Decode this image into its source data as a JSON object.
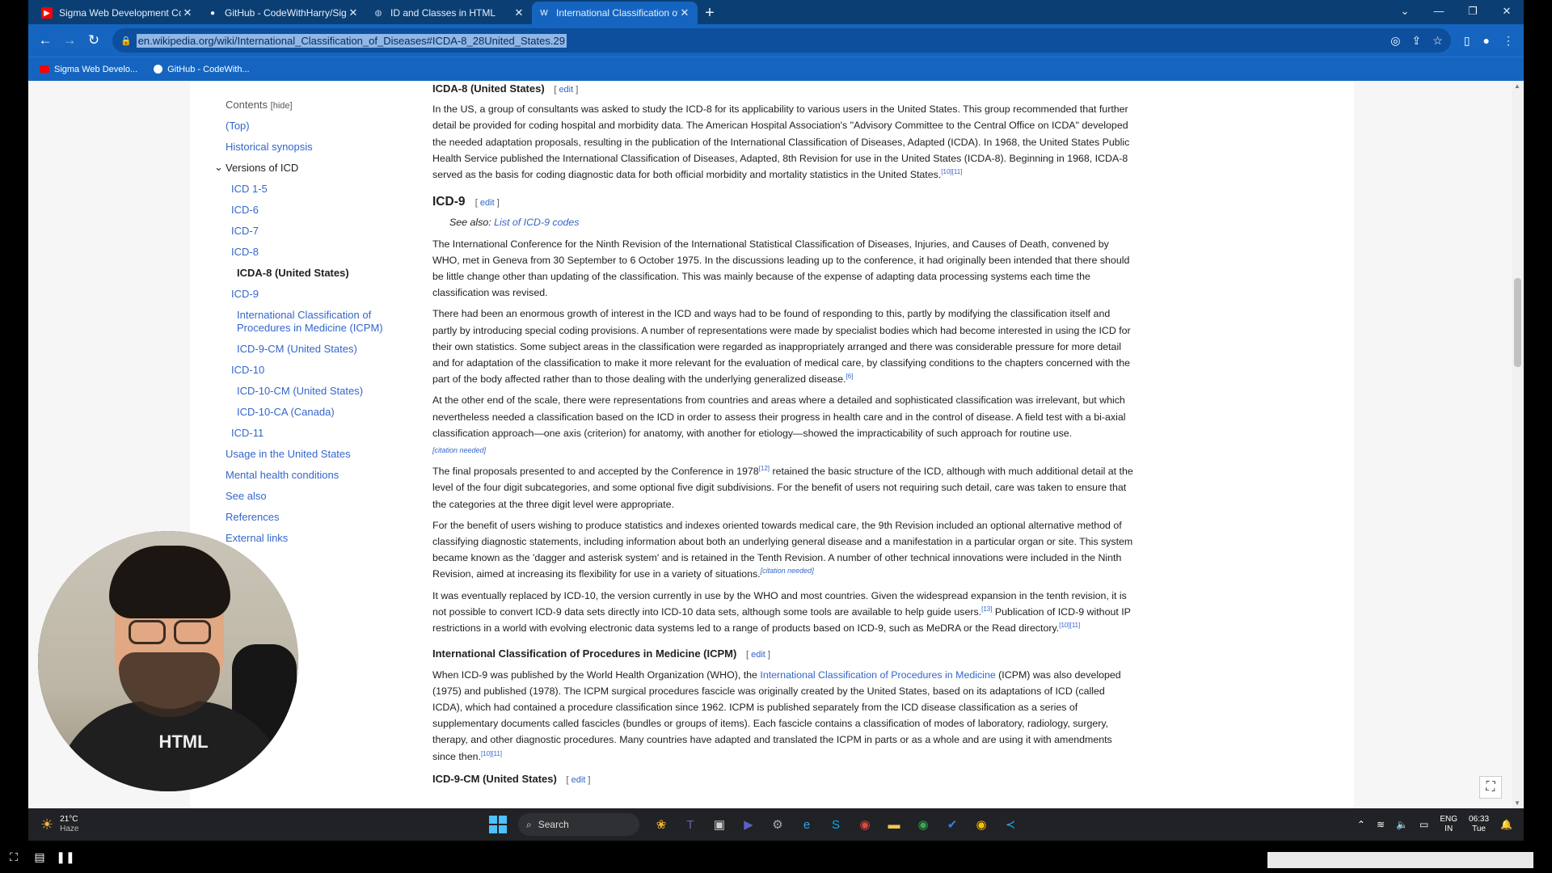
{
  "tabs": [
    {
      "title": "Sigma Web Development Course",
      "color": "#ff0000",
      "glyph": "▶"
    },
    {
      "title": "GitHub - CodeWithHarry/Sigma",
      "color": "#ffffff",
      "glyph": "●"
    },
    {
      "title": "ID and Classes in HTML",
      "color": "#bcd3f3",
      "glyph": "◍"
    },
    {
      "title": "International Classification of Dis",
      "color": "#ffffff",
      "glyph": "W"
    }
  ],
  "new_tab": "+",
  "window_controls": {
    "list": "⌄",
    "minimize": "—",
    "restore": "❐",
    "close": "✕"
  },
  "address_bar": {
    "url": "en.wikipedia.org/wiki/International_Classification_of_Diseases#ICDA-8_28United_States.29"
  },
  "bookmarks": [
    {
      "label": "Sigma Web Develo...",
      "color": "#ff0000"
    },
    {
      "label": "GitHub - CodeWith...",
      "color": "#ffffff"
    }
  ],
  "toc": {
    "title": "Contents",
    "hide": "[hide]",
    "items": [
      {
        "label": "(Top)",
        "level": 1
      },
      {
        "label": "Historical synopsis",
        "level": 1
      },
      {
        "label": "Versions of ICD",
        "level": 1,
        "group": true
      },
      {
        "label": "ICD 1-5",
        "level": 2
      },
      {
        "label": "ICD-6",
        "level": 2
      },
      {
        "label": "ICD-7",
        "level": 2
      },
      {
        "label": "ICD-8",
        "level": 2
      },
      {
        "label": "ICDA-8 (United States)",
        "level": 3,
        "current": true
      },
      {
        "label": "ICD-9",
        "level": 2
      },
      {
        "label": "International Classification of Procedures in Medicine (ICPM)",
        "level": 3
      },
      {
        "label": "ICD-9-CM (United States)",
        "level": 3
      },
      {
        "label": "ICD-10",
        "level": 2
      },
      {
        "label": "ICD-10-CM (United States)",
        "level": 3
      },
      {
        "label": "ICD-10-CA (Canada)",
        "level": 3
      },
      {
        "label": "ICD-11",
        "level": 2
      },
      {
        "label": "Usage in the United States",
        "level": 1
      },
      {
        "label": "Mental health conditions",
        "level": 1
      },
      {
        "label": "See also",
        "level": 1
      },
      {
        "label": "References",
        "level": 1
      },
      {
        "label": "External links",
        "level": 1
      }
    ]
  },
  "article": {
    "edit_label": "edit",
    "icda8": {
      "heading": "ICDA-8 (United States)",
      "p1": "In the US, a group of consultants was asked to study the ICD-8 for its applicability to various users in the United States. This group recommended that further detail be provided for coding hospital and morbidity data. The American Hospital Association's \"Advisory Committee to the Central Office on ICDA\" developed the needed adaptation proposals, resulting in the publication of the International Classification of Diseases, Adapted (ICDA). In 1968, the United States Public Health Service published the International Classification of Diseases, Adapted, 8th Revision for use in the United States (ICDA-8). Beginning in 1968, ICDA-8 served as the basis for coding diagnostic data for both official morbidity and mortality statistics in the United States.",
      "p1_ref": "[10][11]"
    },
    "icd9": {
      "heading": "ICD-9",
      "see_also": "See also:",
      "see_also_link": "List of ICD-9 codes",
      "p1": "The International Conference for the Ninth Revision of the International Statistical Classification of Diseases, Injuries, and Causes of Death, convened by WHO, met in Geneva from 30 September to 6 October 1975. In the discussions leading up to the conference, it had originally been intended that there should be little change other than updating of the classification. This was mainly because of the expense of adapting data processing systems each time the classification was revised.",
      "p2": "There had been an enormous growth of interest in the ICD and ways had to be found of responding to this, partly by modifying the classification itself and partly by introducing special coding provisions. A number of representations were made by specialist bodies which had become interested in using the ICD for their own statistics. Some subject areas in the classification were regarded as inappropriately arranged and there was considerable pressure for more detail and for adaptation of the classification to make it more relevant for the evaluation of medical care, by classifying conditions to the chapters concerned with the part of the body affected rather than to those dealing with the underlying generalized disease.",
      "p2_ref": "[6]",
      "p3": "At the other end of the scale, there were representations from countries and areas where a detailed and sophisticated classification was irrelevant, but which nevertheless needed a classification based on the ICD in order to assess their progress in health care and in the control of disease. A field test with a bi-axial classification approach—one axis (criterion) for anatomy, with another for etiology—showed the impracticability of such approach for routine use.",
      "p3_ref": "[citation needed]",
      "p4a": "The final proposals presented to and accepted by the Conference in 1978",
      "p4_ref": "[12]",
      "p4b": " retained the basic structure of the ICD, although with much additional detail at the level of the four digit subcategories, and some optional five digit subdivisions. For the benefit of users not requiring such detail, care was taken to ensure that the categories at the three digit level were appropriate.",
      "p5": "For the benefit of users wishing to produce statistics and indexes oriented towards medical care, the 9th Revision included an optional alternative method of classifying diagnostic statements, including information about both an underlying general disease and a manifestation in a particular organ or site. This system became known as the 'dagger and asterisk system' and is retained in the Tenth Revision. A number of other technical innovations were included in the Ninth Revision, aimed at increasing its flexibility for use in a variety of situations.",
      "p5_ref": "[citation needed]",
      "p6a": "It was eventually replaced by ICD-10, the version currently in use by the WHO and most countries. Given the widespread expansion in the tenth revision, it is not possible to convert ICD-9 data sets directly into ICD-10 data sets, although some tools are available to help guide users.",
      "p6_ref1": "[13]",
      "p6b": " Publication of ICD-9 without IP restrictions in a world with evolving electronic data systems led to a range of products based on ICD-9, such as MeDRA or the Read directory.",
      "p6_ref2": "[10][11]"
    },
    "icpm": {
      "heading": "International Classification of Procedures in Medicine (ICPM)",
      "p1a": "When ICD-9 was published by the World Health Organization (WHO), the ",
      "p1_link": "International Classification of Procedures in Medicine",
      "p1b": " (ICPM) was also developed (1975) and published (1978). The ICPM surgical procedures fascicle was originally created by the United States, based on its adaptations of ICD (called ICDA), which had contained a procedure classification since 1962. ICPM is published separately from the ICD disease classification as a series of supplementary documents called fascicles (bundles or groups of items). Each fascicle contains a classification of modes of laboratory, radiology, surgery, therapy, and other diagnostic procedures. Many countries have adapted and translated the ICPM in parts or as a whole and are using it with amendments since then.",
      "p1_ref": "[10][11]"
    },
    "icd9cm": {
      "heading": "ICD-9-CM (United States)"
    }
  },
  "webcam": {
    "shirt_text": "HTML"
  },
  "taskbar": {
    "temp": "21°C",
    "condition": "Haze",
    "search_label": "Search",
    "apps": [
      "widgets-icon",
      "teams-icon",
      "taskview-icon",
      "meet-icon",
      "settings-icon",
      "edge-icon",
      "skype-icon",
      "chrome-icon",
      "explorer-icon",
      "chrome-alt-icon",
      "todo-icon",
      "chrome-active-icon",
      "vscode-icon"
    ],
    "lang_1": "ENG",
    "lang_2": "IN",
    "time": "06:33",
    "day": "Tue"
  },
  "player": {
    "progress": 0.817
  }
}
